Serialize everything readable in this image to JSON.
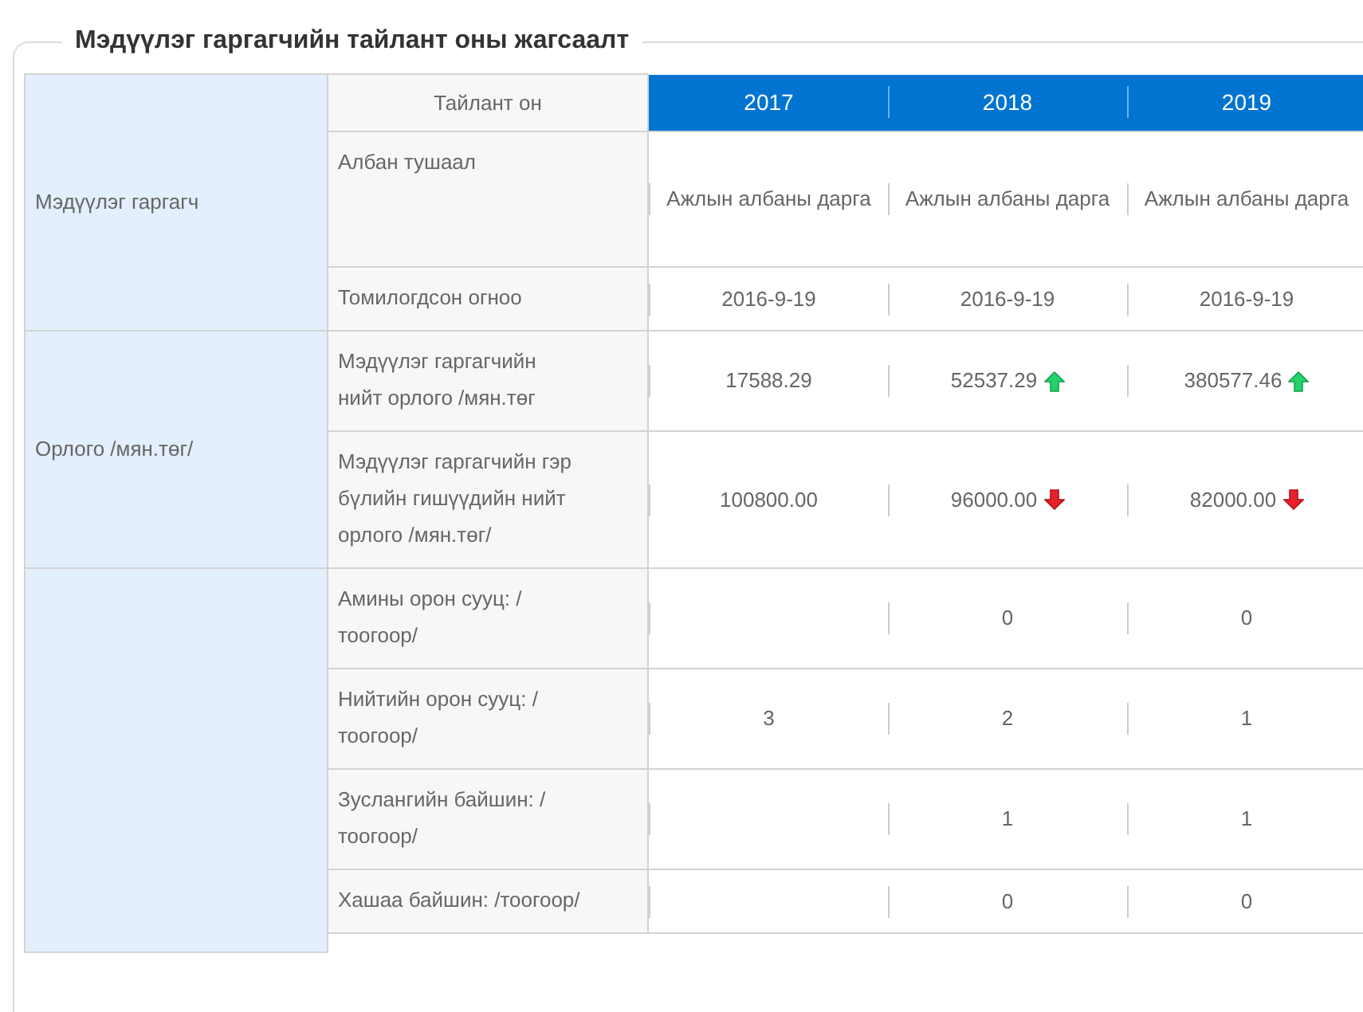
{
  "title": "Мэдүүлэг гаргагчийн тайлант оны жагсаалт",
  "header": {
    "label": "Тайлант он",
    "years": [
      "2017",
      "2018",
      "2019"
    ]
  },
  "groups": [
    {
      "label": "Мэдүүлэг гаргагч",
      "rows": [
        {
          "label": "Албан тушаал",
          "values": [
            {
              "kind": "text",
              "text": "Ажлын албаны дарга"
            },
            {
              "kind": "text",
              "text": "Ажлын албаны дарга"
            },
            {
              "kind": "text",
              "text": "Ажлын албаны дарга"
            }
          ]
        },
        {
          "label": "Томилогдсон огноо",
          "values": [
            {
              "kind": "text",
              "text": "2016-9-19"
            },
            {
              "kind": "text",
              "text": "2016-9-19"
            },
            {
              "kind": "text",
              "text": "2016-9-19"
            }
          ]
        }
      ]
    },
    {
      "label": "Орлого /мян.төг/",
      "rows": [
        {
          "label": "Мэдүүлэг гаргагчийн нийт орлого /мян.төг",
          "values": [
            {
              "kind": "text",
              "text": "17588.29"
            },
            {
              "kind": "text",
              "text": "52537.29",
              "increase": true
            },
            {
              "kind": "text",
              "text": "380577.46",
              "increase": true
            }
          ]
        },
        {
          "label": "Мэдүүлэг гаргагчийн гэр бүлийн гишүүдийн нийт орлого /мян.төг/",
          "values": [
            {
              "kind": "text",
              "text": "100800.00"
            },
            {
              "kind": "text",
              "text": "96000.00",
              "increase": false
            },
            {
              "kind": "text",
              "text": "82000.00",
              "increase": false
            }
          ]
        }
      ]
    },
    {
      "rows": [
        {
          "label": "Амины орон сууц: /тоогоор/",
          "values": [
            {
              "kind": "empty"
            },
            {
              "kind": "text",
              "text": "0"
            },
            {
              "kind": "text",
              "text": "0"
            }
          ]
        },
        {
          "label": "Нийтийн орон сууц: /тоогоор/",
          "values": [
            {
              "kind": "text",
              "text": "3"
            },
            {
              "kind": "text",
              "text": "2"
            },
            {
              "kind": "text",
              "text": "1"
            }
          ]
        },
        {
          "label": "Зуслангийн байшин: /тоогоор/",
          "values": [
            {
              "kind": "empty"
            },
            {
              "kind": "text",
              "text": "1"
            },
            {
              "kind": "text",
              "text": "1"
            }
          ]
        },
        {
          "label": "Хашаа байшин: /тоогоор/",
          "values": [
            {
              "kind": "empty"
            },
            {
              "kind": "text",
              "text": "0"
            },
            {
              "kind": "text",
              "text": "0"
            }
          ]
        }
      ]
    }
  ]
}
